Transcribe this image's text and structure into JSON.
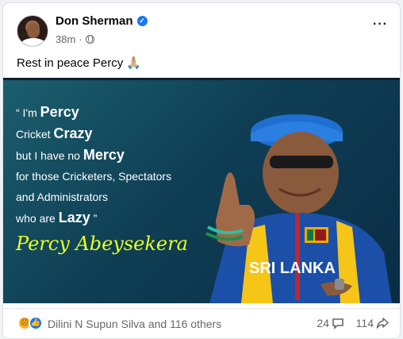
{
  "post": {
    "author": "Don Sherman",
    "time": "38m",
    "text": "Rest in peace Percy 🙏🏼"
  },
  "banner": {
    "quote": {
      "l1a": "“ I'm ",
      "l1b": "Percy",
      "l2a": "Cricket ",
      "l2b": "Crazy",
      "l3a": "but I have no ",
      "l3b": "Mercy",
      "l4": "for those Cricketers, Spectators",
      "l5": "and Administrators",
      "l6a": "who are ",
      "l6b": "Lazy",
      "l6c": " ”"
    },
    "signature": "Percy Abeysekera",
    "shirt_text": "SRI LANKA"
  },
  "stats": {
    "reactions_label": "Dilini N Supun Silva and 116 others",
    "comments": "24",
    "shares": "114"
  },
  "colors": {
    "verified": "#1877f2",
    "signature": "#e7ff21",
    "banner_bg": "#0f3f55"
  }
}
